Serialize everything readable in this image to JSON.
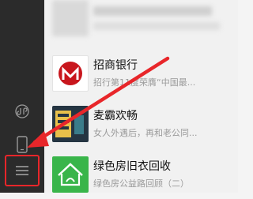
{
  "sidebar": {
    "items": [
      {
        "icon": "mini-program-icon"
      },
      {
        "icon": "phone-icon"
      },
      {
        "icon": "menu-icon"
      }
    ]
  },
  "chats": [
    {
      "name": "",
      "preview": "",
      "avatar_color": "#d7d7d7"
    },
    {
      "name": "招商银行",
      "preview": "招行第11度荣膺“中国最...",
      "avatar_color": "#ffffff"
    },
    {
      "name": "麦霸欢畅",
      "preview": "女人外遇后，再和老公同...",
      "avatar_color": "#253542"
    },
    {
      "name": "绿色房旧衣回收",
      "preview": "绿色房公益路回顾（二）",
      "avatar_color": "#39b54a"
    }
  ],
  "colors": {
    "highlight": "#e8262a",
    "sidebar_bg": "#2b2b2b"
  }
}
